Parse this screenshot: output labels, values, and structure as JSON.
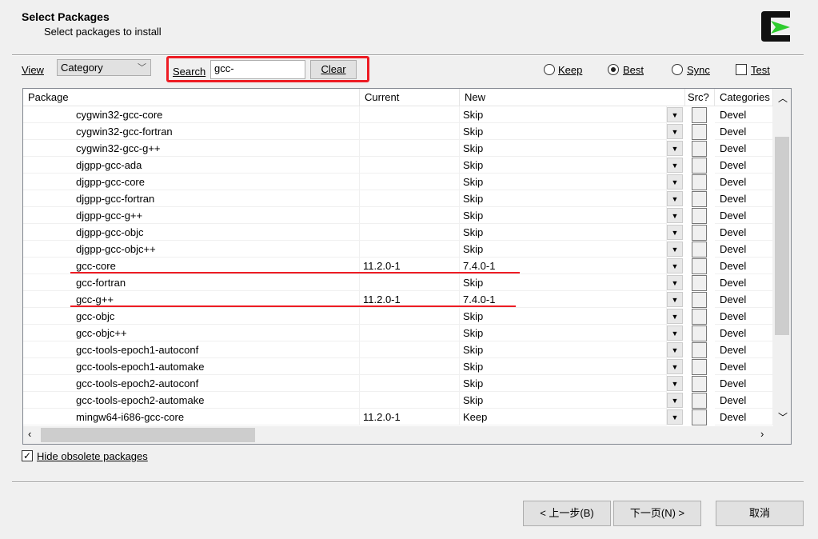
{
  "header": {
    "title": "Select Packages",
    "subtitle": "Select packages to install",
    "logo": "cygwin-logo"
  },
  "toolbar": {
    "view_label": "View",
    "view_value": "Category",
    "search_label": "Search",
    "search_value": "gcc-",
    "clear_label": "Clear",
    "radios": [
      {
        "label": "Keep",
        "checked": false
      },
      {
        "label": "Best",
        "checked": true
      },
      {
        "label": "Sync",
        "checked": false
      }
    ],
    "test_label": "Test",
    "test_checked": false
  },
  "table": {
    "columns": [
      "Package",
      "Current",
      "New",
      "Src?",
      "Categories"
    ],
    "rows": [
      {
        "package": "cygwin32-gcc-core",
        "current": "",
        "new": "Skip",
        "category": "Devel"
      },
      {
        "package": "cygwin32-gcc-fortran",
        "current": "",
        "new": "Skip",
        "category": "Devel"
      },
      {
        "package": "cygwin32-gcc-g++",
        "current": "",
        "new": "Skip",
        "category": "Devel"
      },
      {
        "package": "djgpp-gcc-ada",
        "current": "",
        "new": "Skip",
        "category": "Devel"
      },
      {
        "package": "djgpp-gcc-core",
        "current": "",
        "new": "Skip",
        "category": "Devel"
      },
      {
        "package": "djgpp-gcc-fortran",
        "current": "",
        "new": "Skip",
        "category": "Devel"
      },
      {
        "package": "djgpp-gcc-g++",
        "current": "",
        "new": "Skip",
        "category": "Devel"
      },
      {
        "package": "djgpp-gcc-objc",
        "current": "",
        "new": "Skip",
        "category": "Devel"
      },
      {
        "package": "djgpp-gcc-objc++",
        "current": "",
        "new": "Skip",
        "category": "Devel"
      },
      {
        "package": "gcc-core",
        "current": "11.2.0-1",
        "new": "7.4.0-1",
        "category": "Devel"
      },
      {
        "package": "gcc-fortran",
        "current": "",
        "new": "Skip",
        "category": "Devel"
      },
      {
        "package": "gcc-g++",
        "current": "11.2.0-1",
        "new": "7.4.0-1",
        "category": "Devel"
      },
      {
        "package": "gcc-objc",
        "current": "",
        "new": "Skip",
        "category": "Devel"
      },
      {
        "package": "gcc-objc++",
        "current": "",
        "new": "Skip",
        "category": "Devel"
      },
      {
        "package": "gcc-tools-epoch1-autoconf",
        "current": "",
        "new": "Skip",
        "category": "Devel"
      },
      {
        "package": "gcc-tools-epoch1-automake",
        "current": "",
        "new": "Skip",
        "category": "Devel"
      },
      {
        "package": "gcc-tools-epoch2-autoconf",
        "current": "",
        "new": "Skip",
        "category": "Devel"
      },
      {
        "package": "gcc-tools-epoch2-automake",
        "current": "",
        "new": "Skip",
        "category": "Devel"
      },
      {
        "package": "mingw64-i686-gcc-core",
        "current": "11.2.0-1",
        "new": "Keep",
        "category": "Devel"
      }
    ]
  },
  "hide_obsolete": {
    "label": "Hide obsolete packages",
    "checked": true
  },
  "footer": {
    "back": "< 上一步(B)",
    "next": "下一页(N) >",
    "cancel": "取消"
  },
  "colors": {
    "highlight": "#ed1c24"
  }
}
